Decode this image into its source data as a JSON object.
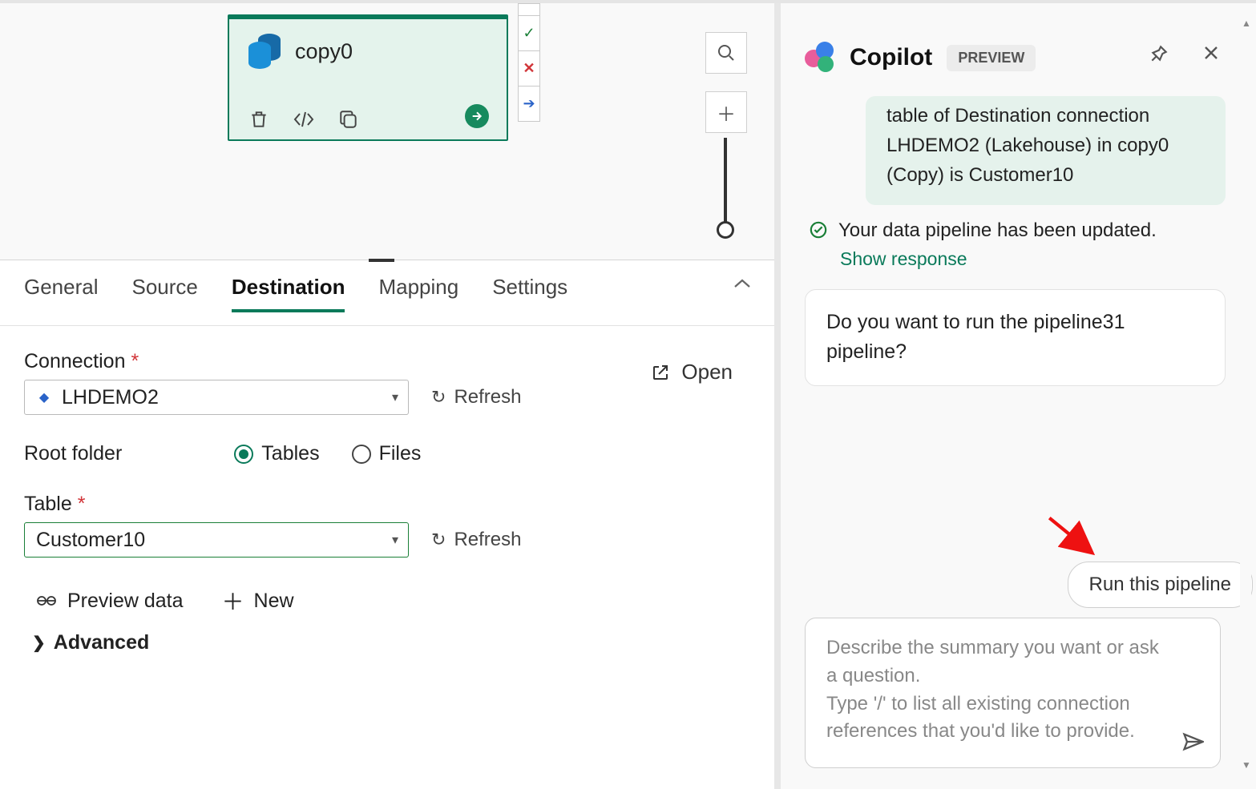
{
  "canvas": {
    "activity_title": "copy0"
  },
  "tabs": {
    "items": [
      "General",
      "Source",
      "Destination",
      "Mapping",
      "Settings"
    ],
    "active_index": 2
  },
  "form": {
    "connection_label": "Connection",
    "connection_value": "LHDEMO2",
    "open_label": "Open",
    "refresh_label": "Refresh",
    "root_folder_label": "Root folder",
    "radios": {
      "tables": "Tables",
      "files": "Files",
      "selected": "tables"
    },
    "table_label": "Table",
    "table_value": "Customer10",
    "preview_label": "Preview data",
    "new_label": "New",
    "advanced_label": "Advanced"
  },
  "copilot": {
    "title": "Copilot",
    "badge": "PREVIEW",
    "system_msg": "table of Destination connection LHDEMO2 (Lakehouse) in copy0 (Copy) is Customer10",
    "updated_msg": "Your data pipeline has been updated.",
    "show_response": "Show response",
    "prompt_msg": "Do you want to run the pipeline31 pipeline?",
    "run_btn": "Run this pipeline",
    "input_placeholder": "Describe the summary you want or ask a question.\nType '/' to list all existing connection references that you'd like to provide."
  }
}
